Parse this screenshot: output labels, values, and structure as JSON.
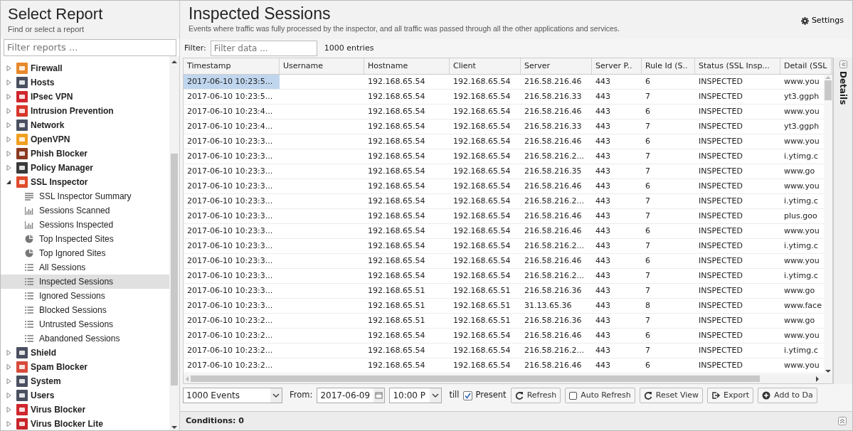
{
  "sidebar": {
    "title": "Select Report",
    "subtitle": "Find or select a report",
    "filter": {
      "placeholder": "Filter reports ..."
    },
    "tree": [
      {
        "label": "Firewall",
        "color": "#e8892c",
        "expanded": false,
        "selected": false
      },
      {
        "label": "Hosts",
        "color": "#4a5060",
        "expanded": false,
        "selected": false
      },
      {
        "label": "IPsec VPN",
        "color": "#d0262d",
        "expanded": false,
        "selected": false
      },
      {
        "label": "Intrusion Prevention",
        "color": "#d7372a",
        "expanded": false,
        "selected": false
      },
      {
        "label": "Network",
        "color": "#4a5060",
        "expanded": false,
        "selected": false
      },
      {
        "label": "OpenVPN",
        "color": "#f0a020",
        "expanded": false,
        "selected": false
      },
      {
        "label": "Phish Blocker",
        "color": "#8a3a20",
        "expanded": false,
        "selected": false
      },
      {
        "label": "Policy Manager",
        "color": "#3a3a3a",
        "expanded": false,
        "selected": false
      },
      {
        "label": "SSL Inspector",
        "color": "#e04a2a",
        "expanded": true,
        "selected": false,
        "children": [
          {
            "label": "SSL Inspector Summary",
            "kind": "text",
            "selected": false
          },
          {
            "label": "Sessions Scanned",
            "kind": "bar",
            "selected": false
          },
          {
            "label": "Sessions Inspected",
            "kind": "bar",
            "selected": false
          },
          {
            "label": "Top Inspected Sites",
            "kind": "pie",
            "selected": false
          },
          {
            "label": "Top Ignored Sites",
            "kind": "pie",
            "selected": false
          },
          {
            "label": "All Sessions",
            "kind": "list",
            "selected": false
          },
          {
            "label": "Inspected Sessions",
            "kind": "list",
            "selected": true
          },
          {
            "label": "Ignored Sessions",
            "kind": "list",
            "selected": false
          },
          {
            "label": "Blocked Sessions",
            "kind": "list",
            "selected": false
          },
          {
            "label": "Untrusted Sessions",
            "kind": "list",
            "selected": false
          },
          {
            "label": "Abandoned Sessions",
            "kind": "list",
            "selected": false
          }
        ]
      },
      {
        "label": "Shield",
        "color": "#4a5060",
        "expanded": false,
        "selected": false
      },
      {
        "label": "Spam Blocker",
        "color": "#d84a3a",
        "expanded": false,
        "selected": false
      },
      {
        "label": "System",
        "color": "#4a5060",
        "expanded": false,
        "selected": false
      },
      {
        "label": "Users",
        "color": "#4a5060",
        "expanded": false,
        "selected": false
      },
      {
        "label": "Virus Blocker",
        "color": "#d0262d",
        "expanded": false,
        "selected": false
      },
      {
        "label": "Virus Blocker Lite",
        "color": "#c8232a",
        "expanded": false,
        "selected": false
      }
    ]
  },
  "main": {
    "title": "Inspected Sessions",
    "description": "Events where traffic was fully processed by the inspector, and all traffic was passed through all the other applications and services.",
    "settings": "Settings",
    "filter": {
      "label": "Filter:",
      "placeholder": "Filter data ...",
      "count": "1000 entries"
    },
    "table": {
      "columns": [
        "Timestamp",
        "Username",
        "Hostname",
        "Client",
        "Server",
        "Server P..",
        "Rule Id (S..",
        "Status (SSL Insp...",
        "Detail (SSL"
      ],
      "rows": [
        {
          "selected": true,
          "cells": [
            "2017-06-10 10:23:5...",
            "",
            "192.168.65.54",
            "192.168.65.54",
            "216.58.216.46",
            "443",
            "6",
            "INSPECTED",
            "www.you"
          ]
        },
        {
          "selected": false,
          "cells": [
            "2017-06-10 10:23:5...",
            "",
            "192.168.65.54",
            "192.168.65.54",
            "216.58.216.33",
            "443",
            "7",
            "INSPECTED",
            "yt3.ggph"
          ]
        },
        {
          "selected": false,
          "cells": [
            "2017-06-10 10:23:4...",
            "",
            "192.168.65.54",
            "192.168.65.54",
            "216.58.216.46",
            "443",
            "6",
            "INSPECTED",
            "www.you"
          ]
        },
        {
          "selected": false,
          "cells": [
            "2017-06-10 10:23:4...",
            "",
            "192.168.65.54",
            "192.168.65.54",
            "216.58.216.33",
            "443",
            "7",
            "INSPECTED",
            "yt3.ggph"
          ]
        },
        {
          "selected": false,
          "cells": [
            "2017-06-10 10:23:3...",
            "",
            "192.168.65.54",
            "192.168.65.54",
            "216.58.216.46",
            "443",
            "6",
            "INSPECTED",
            "www.you"
          ]
        },
        {
          "selected": false,
          "cells": [
            "2017-06-10 10:23:3...",
            "",
            "192.168.65.54",
            "192.168.65.54",
            "216.58.216.2...",
            "443",
            "7",
            "INSPECTED",
            "i.ytimg.c"
          ]
        },
        {
          "selected": false,
          "cells": [
            "2017-06-10 10:23:3...",
            "",
            "192.168.65.54",
            "192.168.65.54",
            "216.58.216.35",
            "443",
            "7",
            "INSPECTED",
            "www.go"
          ]
        },
        {
          "selected": false,
          "cells": [
            "2017-06-10 10:23:3...",
            "",
            "192.168.65.54",
            "192.168.65.54",
            "216.58.216.46",
            "443",
            "6",
            "INSPECTED",
            "www.you"
          ]
        },
        {
          "selected": false,
          "cells": [
            "2017-06-10 10:23:3...",
            "",
            "192.168.65.54",
            "192.168.65.54",
            "216.58.216.2...",
            "443",
            "7",
            "INSPECTED",
            "i.ytimg.c"
          ]
        },
        {
          "selected": false,
          "cells": [
            "2017-06-10 10:23:3...",
            "",
            "192.168.65.54",
            "192.168.65.54",
            "216.58.216.46",
            "443",
            "7",
            "INSPECTED",
            "plus.goo"
          ]
        },
        {
          "selected": false,
          "cells": [
            "2017-06-10 10:23:3...",
            "",
            "192.168.65.54",
            "192.168.65.54",
            "216.58.216.46",
            "443",
            "6",
            "INSPECTED",
            "www.you"
          ]
        },
        {
          "selected": false,
          "cells": [
            "2017-06-10 10:23:3...",
            "",
            "192.168.65.54",
            "192.168.65.54",
            "216.58.216.2...",
            "443",
            "7",
            "INSPECTED",
            "i.ytimg.c"
          ]
        },
        {
          "selected": false,
          "cells": [
            "2017-06-10 10:23:3...",
            "",
            "192.168.65.54",
            "192.168.65.54",
            "216.58.216.46",
            "443",
            "6",
            "INSPECTED",
            "www.you"
          ]
        },
        {
          "selected": false,
          "cells": [
            "2017-06-10 10:23:3...",
            "",
            "192.168.65.54",
            "192.168.65.54",
            "216.58.216.2...",
            "443",
            "7",
            "INSPECTED",
            "i.ytimg.c"
          ]
        },
        {
          "selected": false,
          "cells": [
            "2017-06-10 10:23:3...",
            "",
            "192.168.65.51",
            "192.168.65.51",
            "216.58.216.36",
            "443",
            "7",
            "INSPECTED",
            "www.go"
          ]
        },
        {
          "selected": false,
          "cells": [
            "2017-06-10 10:23:3...",
            "",
            "192.168.65.51",
            "192.168.65.51",
            "31.13.65.36",
            "443",
            "8",
            "INSPECTED",
            "www.face"
          ]
        },
        {
          "selected": false,
          "cells": [
            "2017-06-10 10:23:2...",
            "",
            "192.168.65.51",
            "192.168.65.51",
            "216.58.216.36",
            "443",
            "7",
            "INSPECTED",
            "www.go"
          ]
        },
        {
          "selected": false,
          "cells": [
            "2017-06-10 10:23:2...",
            "",
            "192.168.65.54",
            "192.168.65.54",
            "216.58.216.46",
            "443",
            "6",
            "INSPECTED",
            "www.you"
          ]
        },
        {
          "selected": false,
          "cells": [
            "2017-06-10 10:23:2...",
            "",
            "192.168.65.54",
            "192.168.65.54",
            "216.58.216.2...",
            "443",
            "7",
            "INSPECTED",
            "i.ytimg.c"
          ]
        },
        {
          "selected": false,
          "cells": [
            "2017-06-10 10:23:2...",
            "",
            "192.168.65.54",
            "192.168.65.54",
            "216.58.216.46",
            "443",
            "6",
            "INSPECTED",
            "www.you"
          ]
        }
      ]
    },
    "toolbar": {
      "events": "1000 Events",
      "from_label": "From:",
      "date": "2017-06-09",
      "time": "10:00 P",
      "till_label": "till",
      "present": {
        "label": "Present",
        "checked": true
      },
      "buttons": [
        {
          "kind": "refresh",
          "label": "Refresh"
        },
        {
          "kind": "toggle",
          "label": "Auto Refresh",
          "checked": false
        },
        {
          "kind": "refresh",
          "label": "Reset View"
        },
        {
          "kind": "export",
          "label": "Export"
        },
        {
          "kind": "add",
          "label": "Add to Da"
        }
      ]
    },
    "conditions": "Conditions: 0",
    "details": "Details"
  }
}
